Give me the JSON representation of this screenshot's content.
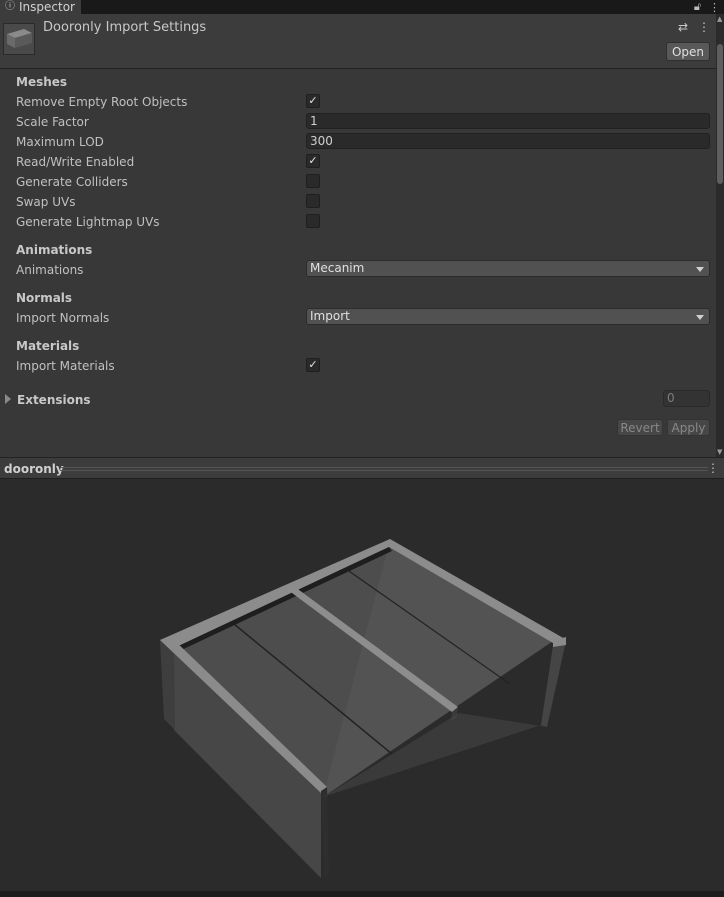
{
  "tab": {
    "icon": "info-icon",
    "label": "Inspector"
  },
  "header": {
    "title": "Dooronly Import Settings",
    "open_label": "Open"
  },
  "meshes": {
    "section": "Meshes",
    "rows": [
      {
        "label": "Remove Empty Root Objects",
        "type": "checkbox",
        "checked": true
      },
      {
        "label": "Scale Factor",
        "type": "text",
        "value": "1"
      },
      {
        "label": "Maximum LOD",
        "type": "text",
        "value": "300"
      },
      {
        "label": "Read/Write Enabled",
        "type": "checkbox",
        "checked": true
      },
      {
        "label": "Generate Colliders",
        "type": "checkbox",
        "checked": false
      },
      {
        "label": "Swap UVs",
        "type": "checkbox",
        "checked": false
      },
      {
        "label": "Generate Lightmap UVs",
        "type": "checkbox",
        "checked": false
      }
    ]
  },
  "animations": {
    "section": "Animations",
    "label": "Animations",
    "value": "Mecanim"
  },
  "normals": {
    "section": "Normals",
    "label": "Import Normals",
    "value": "Import"
  },
  "materials": {
    "section": "Materials",
    "label": "Import Materials",
    "checked": true
  },
  "extensions": {
    "label": "Extensions",
    "count": "0"
  },
  "actions": {
    "revert": "Revert",
    "apply": "Apply"
  },
  "preview": {
    "title": "dooronly"
  },
  "check_glyph": "✓"
}
